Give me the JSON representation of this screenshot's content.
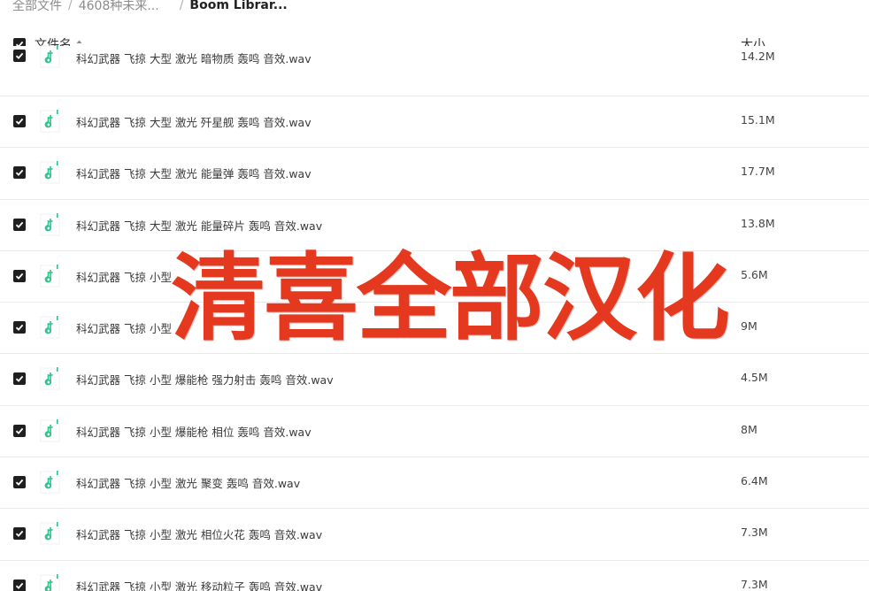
{
  "breadcrumb": {
    "items": [
      "全部文件",
      "4608种未来...",
      "Boom Librar..."
    ]
  },
  "header": {
    "name_label": "文件名",
    "size_label": "大小"
  },
  "files": [
    {
      "name": "科幻武器 飞掠 大型 激光 暗物质 轰鸣 音效.wav",
      "size": "14.2M"
    },
    {
      "name": "科幻武器 飞掠 大型 激光 歼星舰 轰鸣 音效.wav",
      "size": "15.1M"
    },
    {
      "name": "科幻武器 飞掠 大型 激光 能量弹 轰鸣 音效.wav",
      "size": "17.7M"
    },
    {
      "name": "科幻武器 飞掠 大型 激光 能量碎片 轰鸣 音效.wav",
      "size": "13.8M"
    },
    {
      "name": "科幻武器 飞掠 小型",
      "size": "5.6M"
    },
    {
      "name": "科幻武器 飞掠 小型",
      "size": "9M"
    },
    {
      "name": "科幻武器 飞掠 小型 爆能枪 强力射击 轰鸣 音效.wav",
      "size": "4.5M"
    },
    {
      "name": "科幻武器 飞掠 小型 爆能枪 相位 轰鸣 音效.wav",
      "size": "8M"
    },
    {
      "name": "科幻武器 飞掠 小型 激光 聚变 轰鸣 音效.wav",
      "size": "6.4M"
    },
    {
      "name": "科幻武器 飞掠 小型 激光 相位火花 轰鸣 音效.wav",
      "size": "7.3M"
    },
    {
      "name": "科幻武器 飞掠 小型 激光 移动粒子 轰鸣 音效.wav",
      "size": "7.3M"
    }
  ],
  "overlay_text": "清喜全部汉化",
  "colors": {
    "overlay": "#e5391f",
    "icon_accent": "#2ec28b",
    "checkbox": "#1f1f1f"
  }
}
